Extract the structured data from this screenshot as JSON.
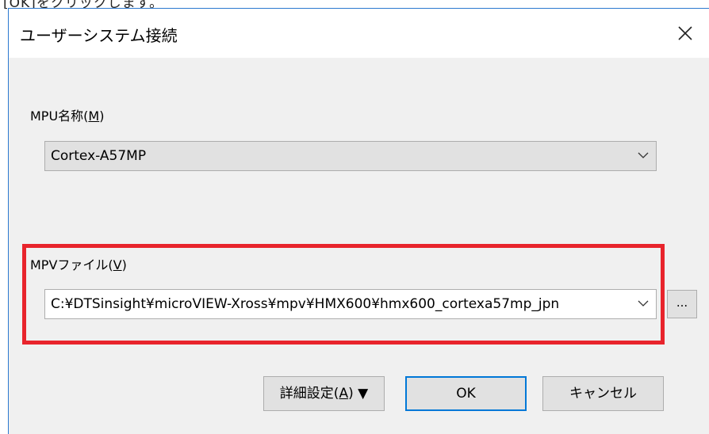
{
  "background_text": "[OK]をクリックします。",
  "dialog": {
    "title": "ユーザーシステム接続",
    "close_icon": "close-icon"
  },
  "mpu": {
    "label_text": "MPU名称(",
    "label_mnemonic": "M",
    "label_close": ")",
    "selected": "Cortex-A57MP"
  },
  "mpv": {
    "label_text": "MPVファイル(",
    "label_mnemonic": "V",
    "label_close": ")",
    "selected": "C:¥DTSinsight¥microVIEW-Xross¥mpv¥HMX600¥hmx600_cortexa57mp_jpn",
    "browse_label": "..."
  },
  "buttons": {
    "advanced_label": "詳細設定(",
    "advanced_mnemonic": "A",
    "advanced_suffix": ") ▼",
    "ok": "OK",
    "cancel": "キャンセル"
  },
  "colors": {
    "highlight_border": "#e8242c",
    "dialog_border": "#2b78d0",
    "ok_border": "#0078d7"
  }
}
